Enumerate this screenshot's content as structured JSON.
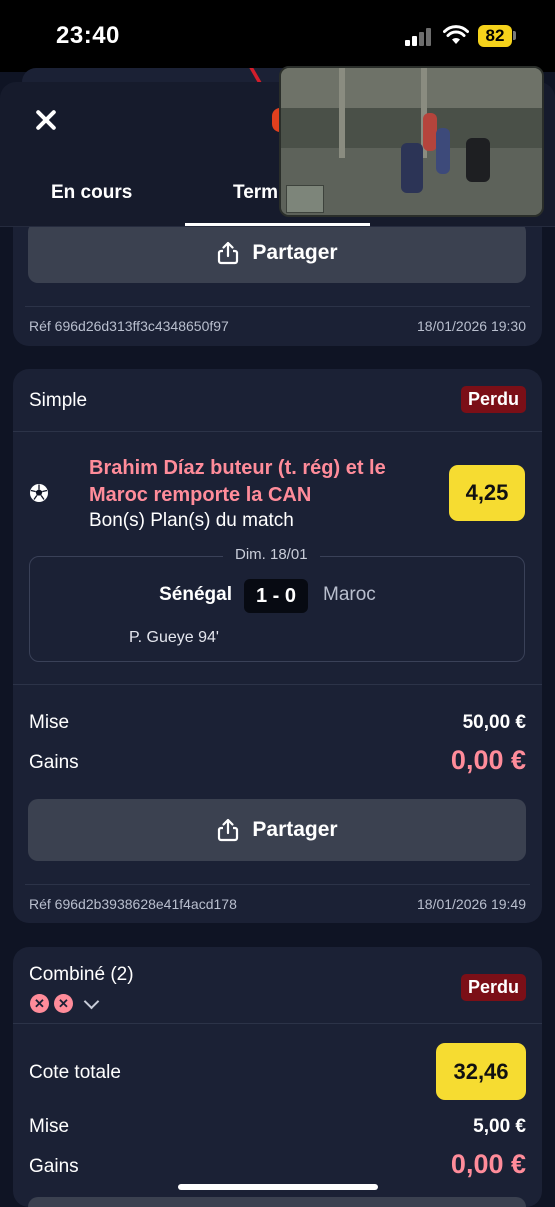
{
  "status_bar": {
    "time": "23:40",
    "battery": "82"
  },
  "tabs": [
    {
      "label": "En cours"
    },
    {
      "label": "Term"
    }
  ],
  "card1": {
    "share_label": "Partager",
    "ref": "Réf 696d26d313ff3c4348650f97",
    "date": "18/01/2026 19:30"
  },
  "card2": {
    "type": "Simple",
    "status": "Perdu",
    "selection": "Brahim Díaz buteur (t. rég) et le Maroc remporte la CAN",
    "market": "Bon(s) Plan(s) du match",
    "odds": "4,25",
    "match_date": "Dim. 18/01",
    "home_team": "Sénégal",
    "score": "1 - 0",
    "away_team": "Maroc",
    "scorer": "P. Gueye 94'",
    "mise_label": "Mise",
    "mise_value": "50,00 €",
    "gains_label": "Gains",
    "gains_value": "0,00 €",
    "share_label": "Partager",
    "ref": "Réf 696d2b3938628e41f4acd178",
    "date": "18/01/2026 19:49"
  },
  "card3": {
    "type": "Combiné (2)",
    "status": "Perdu",
    "cote_label": "Cote totale",
    "cote_value": "32,46",
    "mise_label": "Mise",
    "mise_value": "5,00 €",
    "gains_label": "Gains",
    "gains_value": "0,00 €"
  },
  "colors": {
    "background": "#0f1424",
    "card": "#1b2135",
    "loss_red": "#7b0f17",
    "gains_pink": "#ff8c9a",
    "odds_yellow": "#f6dc31"
  }
}
